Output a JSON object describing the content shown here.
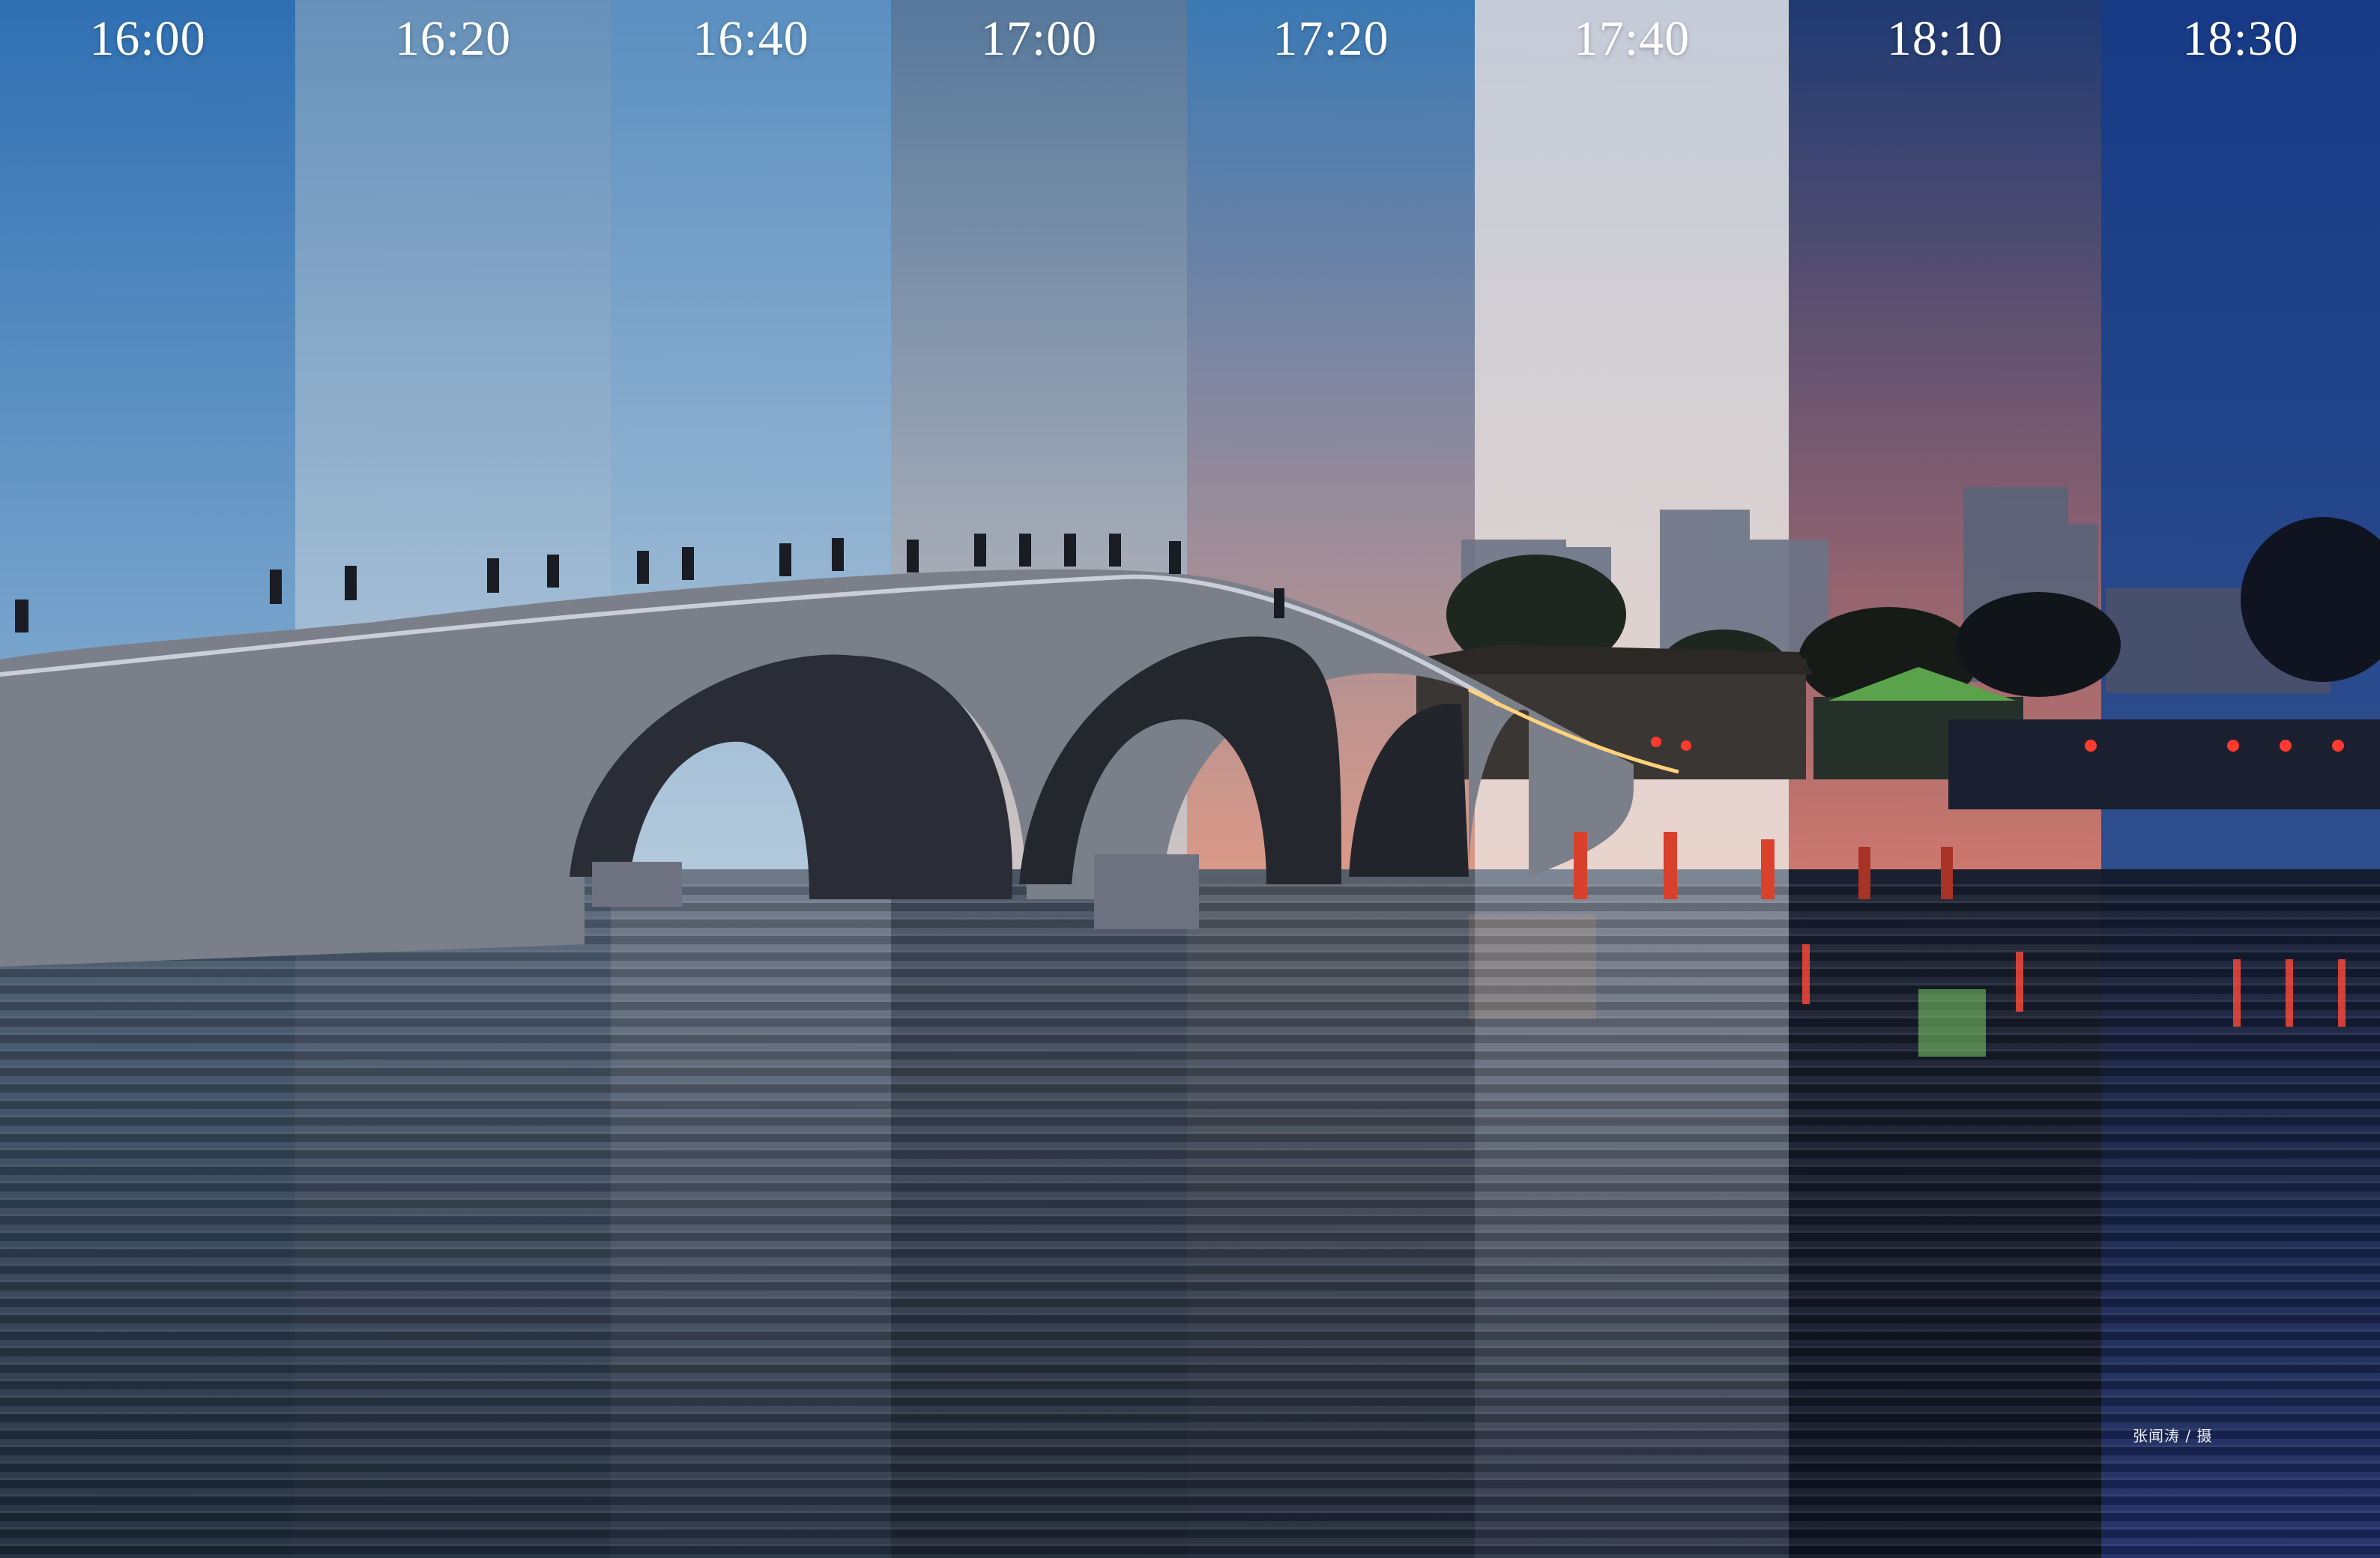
{
  "panels": [
    {
      "time": "16:00",
      "sky_top": "#2f6fb2",
      "sky_bottom": "#93b8d6",
      "water_top": "#4d5f74",
      "water_bottom": "#1d2a3a"
    },
    {
      "time": "16:20",
      "sky_top": "#6791ba",
      "sky_bottom": "#bccfe0",
      "water_top": "#59687c",
      "water_bottom": "#202c3c"
    },
    {
      "time": "16:40",
      "sky_top": "#5a8fc0",
      "sky_bottom": "#b6cbdc",
      "water_top": "#6e7a8a",
      "water_bottom": "#253142"
    },
    {
      "time": "17:00",
      "sky_top": "#56789c",
      "sky_bottom": "#d3c9c6",
      "water_top": "#4a5566",
      "water_bottom": "#1d2634"
    },
    {
      "time": "17:20",
      "sky_top": "#3a79b4",
      "sky_bottom": "#e09a86",
      "water_top": "#58606c",
      "water_bottom": "#1e2736"
    },
    {
      "time": "17:40",
      "sky_top": "#c4ccd8",
      "sky_bottom": "#e9d4cc",
      "water_top": "#7d8694",
      "water_bottom": "#2c3444"
    },
    {
      "time": "18:10",
      "sky_top": "#1e3a72",
      "sky_bottom": "#d27a6e",
      "water_top": "#1a2030",
      "water_bottom": "#0e1524"
    },
    {
      "time": "18:30",
      "sky_top": "#173a86",
      "sky_bottom": "#2f4f8e",
      "water_top": "#141c30",
      "water_bottom": "#1c2c66"
    }
  ],
  "credit": "张闻涛 / 摄"
}
